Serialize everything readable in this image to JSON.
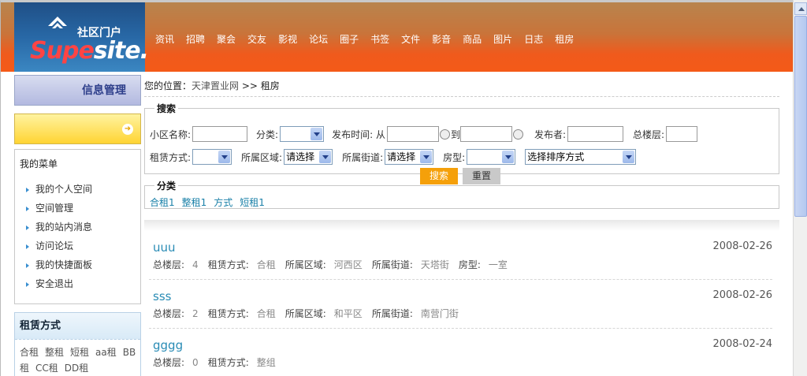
{
  "logo": {
    "cn": "社区门户",
    "en_a": "Supe",
    "en_b": "site."
  },
  "nav": [
    "资讯",
    "招聘",
    "聚会",
    "交友",
    "影视",
    "论坛",
    "圈子",
    "书签",
    "文件",
    "影音",
    "商品",
    "图片",
    "日志",
    "租房"
  ],
  "sidebar": {
    "title": "信息管理",
    "menu_title": "我的菜单",
    "menu": [
      "我的个人空间",
      "空间管理",
      "我的站内消息",
      "访问论坛",
      "我的快捷面板",
      "安全退出"
    ],
    "rent_title": "租赁方式",
    "rent_tags": [
      "合租",
      "整租",
      "短租",
      "aa租",
      "BB租",
      "CC租",
      "DD租"
    ]
  },
  "breadcrumb": {
    "label": "您的位置：",
    "site": "天津置业网",
    "sep": ">>",
    "current": "租房"
  },
  "search": {
    "legend": "搜索",
    "community_label": "小区名称:",
    "category_label": "分类:",
    "time_label": "发布时间: 从",
    "to_label": "到",
    "publisher_label": "发布者:",
    "floors_label": "总楼层:",
    "rent_label": "租赁方式:",
    "district_label": "所属区域:",
    "district_value": "请选择",
    "street_label": "所属街道:",
    "street_value": "请选择",
    "room_label": "房型:",
    "sort_value": "选择排序方式",
    "search_btn": "搜索",
    "reset_btn": "重置"
  },
  "categories": {
    "legend": "分类",
    "items": [
      "合租1",
      "整租1",
      "方式",
      "短租1"
    ]
  },
  "listings": [
    {
      "title": "uuu",
      "date": "2008-02-26",
      "meta": [
        [
          "总楼层:",
          "4"
        ],
        [
          "租赁方式:",
          "合租"
        ],
        [
          "所属区域:",
          "河西区"
        ],
        [
          "所属街道:",
          "天塔街"
        ],
        [
          "房型:",
          "一室"
        ]
      ]
    },
    {
      "title": "sss",
      "date": "2008-02-26",
      "meta": [
        [
          "总楼层:",
          "2"
        ],
        [
          "租赁方式:",
          "合租"
        ],
        [
          "所属区域:",
          "和平区"
        ],
        [
          "所属街道:",
          "南营门街"
        ]
      ]
    },
    {
      "title": "gggg",
      "date": "2008-02-24",
      "meta": [
        [
          "总楼层:",
          "0"
        ],
        [
          "租赁方式:",
          "整组"
        ]
      ]
    }
  ]
}
